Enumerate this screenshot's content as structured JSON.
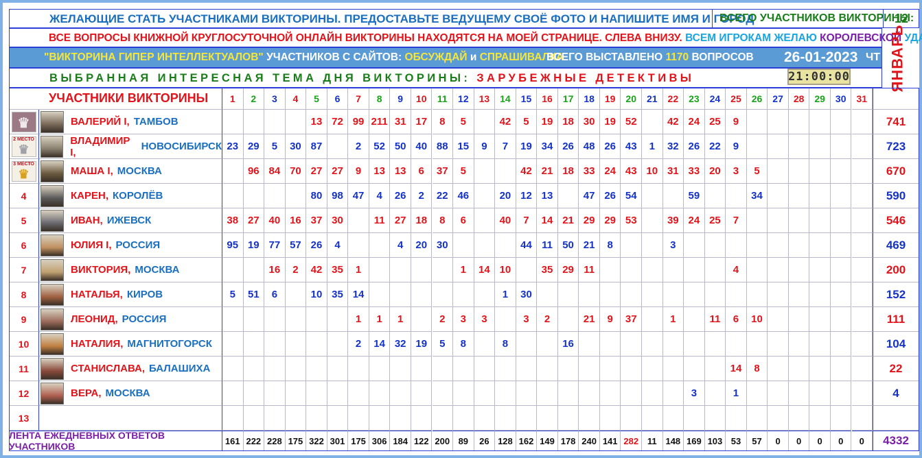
{
  "header": {
    "line1": "ЖЕЛАЮЩИЕ  СТАТЬ  УЧАСТНИКАМИ  ВИКТОРИНЫ.  ПРЕДОСТАВЬТЕ  ВЕДУЩЕМУ  СВОЁ  ФОТО  И  НАПИШИТЕ  ИМЯ И ГОРОД",
    "total_label": "ВСЕГО УЧАСТНИКОВ ВИКТОРИНЫ:",
    "total_value": "12",
    "line2_red": "ВСЕ ВОПРОСЫ КНИЖНОЙ КРУГЛОСУТОЧНОЙ ОНЛАЙН ВИКТОРИНЫ НАХОДЯТСЯ НА МОЕЙ СТРАНИЦЕ. СЛЕВА ВНИЗУ.",
    "line2_w1": "ВСЕМ",
    "line2_w2": "ИГРОКАМ",
    "line2_w3": "ЖЕЛАЮ",
    "line2_w4": "КОРОЛЕВСКОЙ",
    "line2_w5": "УДАЧИ!",
    "quiz_name": "\"ВИКТОРИНА ГИПЕР ИНТЕЛЛЕКТУАЛОВ\"",
    "sites_label": "УЧАСТНИКОВ С САЙТОВ:",
    "site1": "ОБСУЖДАЙ",
    "and": "и",
    "site2": "СПРАШИВАЛКА",
    "questions_label": "ВСЕГО ВЫСТАВЛЕНО",
    "questions_value": "1170",
    "questions_unit": "ВОПРОСОВ",
    "date": "26-01-2023",
    "weekday": "ЧТ",
    "month": "ЯНВАРЬ",
    "theme_label": "ВЫБРАННАЯ  ИНТЕРЕСНАЯ  ТЕМА  ДНЯ  ВИКТОРИНЫ:",
    "theme_value": "ЗАРУБЕЖНЫЕ  ДЕТЕКТИВЫ",
    "clock": "21:00:00"
  },
  "table": {
    "participants_header": "УЧАСТНИКИ ВИКТОРИНЫ",
    "days": [
      "1",
      "2",
      "3",
      "4",
      "5",
      "6",
      "7",
      "8",
      "9",
      "10",
      "11",
      "12",
      "13",
      "14",
      "15",
      "16",
      "17",
      "18",
      "19",
      "20",
      "21",
      "22",
      "23",
      "24",
      "25",
      "26",
      "27",
      "28",
      "29",
      "30",
      "31"
    ],
    "medals": [
      "",
      "2 МЕСТО",
      "3 МЕСТО"
    ],
    "rows": [
      {
        "rank": "1",
        "name": "ВАЛЕРИЙ I,",
        "city": "ТАМБОВ",
        "scores": [
          "",
          "",
          "",
          "",
          "13",
          "72",
          "99",
          "211",
          "31",
          "17",
          "8",
          "5",
          "",
          "42",
          "5",
          "19",
          "18",
          "30",
          "19",
          "52",
          "",
          "42",
          "24",
          "25",
          "9",
          "",
          "",
          "",
          "",
          "",
          ""
        ],
        "total": "741"
      },
      {
        "rank": "2",
        "name": "ВЛАДИМИР I,",
        "city": "НОВОСИБИРСК",
        "scores": [
          "23",
          "29",
          "5",
          "30",
          "87",
          "",
          "2",
          "52",
          "50",
          "40",
          "88",
          "15",
          "9",
          "7",
          "19",
          "34",
          "26",
          "48",
          "26",
          "43",
          "1",
          "32",
          "26",
          "22",
          "9",
          "",
          "",
          "",
          "",
          "",
          ""
        ],
        "total": "723"
      },
      {
        "rank": "3",
        "name": "МАША I,",
        "city": "МОСКВА",
        "scores": [
          "",
          "96",
          "84",
          "70",
          "27",
          "27",
          "9",
          "13",
          "13",
          "6",
          "37",
          "5",
          "",
          "",
          "42",
          "21",
          "18",
          "33",
          "24",
          "43",
          "10",
          "31",
          "33",
          "20",
          "3",
          "5",
          "",
          "",
          "",
          "",
          ""
        ],
        "total": "670"
      },
      {
        "rank": "4",
        "name": "КАРЕН,",
        "city": "КОРОЛЁВ",
        "scores": [
          "",
          "",
          "",
          "",
          "80",
          "98",
          "47",
          "4",
          "26",
          "2",
          "22",
          "46",
          "",
          "20",
          "12",
          "13",
          "",
          "47",
          "26",
          "54",
          "",
          "",
          "59",
          "",
          "",
          "34",
          "",
          "",
          "",
          "",
          ""
        ],
        "total": "590"
      },
      {
        "rank": "5",
        "name": "ИВАН,",
        "city": "ИЖЕВСК",
        "scores": [
          "38",
          "27",
          "40",
          "16",
          "37",
          "30",
          "",
          "11",
          "27",
          "18",
          "8",
          "6",
          "",
          "40",
          "7",
          "14",
          "21",
          "29",
          "29",
          "53",
          "",
          "39",
          "24",
          "25",
          "7",
          "",
          "",
          "",
          "",
          "",
          ""
        ],
        "total": "546"
      },
      {
        "rank": "6",
        "name": "ЮЛИЯ I,",
        "city": "РОССИЯ",
        "scores": [
          "95",
          "19",
          "77",
          "57",
          "26",
          "4",
          "",
          "",
          "4",
          "20",
          "30",
          "",
          "",
          "",
          "44",
          "11",
          "50",
          "21",
          "8",
          "",
          "",
          "3",
          "",
          "",
          "",
          "",
          "",
          "",
          "",
          "",
          ""
        ],
        "total": "469"
      },
      {
        "rank": "7",
        "name": "ВИКТОРИЯ,",
        "city": "МОСКВА",
        "scores": [
          "",
          "",
          "16",
          "2",
          "42",
          "35",
          "1",
          "",
          "",
          "",
          "",
          "1",
          "14",
          "10",
          "",
          "35",
          "29",
          "11",
          "",
          "",
          "",
          "",
          "",
          "",
          "4",
          "",
          "",
          "",
          "",
          "",
          ""
        ],
        "total": "200"
      },
      {
        "rank": "8",
        "name": "НАТАЛЬЯ,",
        "city": "КИРОВ",
        "scores": [
          "5",
          "51",
          "6",
          "",
          "10",
          "35",
          "14",
          "",
          "",
          "",
          "",
          "",
          "",
          "1",
          "30",
          "",
          "",
          "",
          "",
          "",
          "",
          "",
          "",
          "",
          "",
          "",
          "",
          "",
          "",
          "",
          ""
        ],
        "total": "152"
      },
      {
        "rank": "9",
        "name": "ЛЕОНИД,",
        "city": "РОССИЯ",
        "scores": [
          "",
          "",
          "",
          "",
          "",
          "",
          "1",
          "1",
          "1",
          "",
          "2",
          "3",
          "3",
          "",
          "3",
          "2",
          "",
          "21",
          "9",
          "37",
          "",
          "1",
          "",
          "11",
          "6",
          "10",
          "",
          "",
          "",
          "",
          ""
        ],
        "total": "111"
      },
      {
        "rank": "10",
        "name": "НАТАЛИЯ,",
        "city": "МАГНИТОГОРСК",
        "scores": [
          "",
          "",
          "",
          "",
          "",
          "",
          "2",
          "14",
          "32",
          "19",
          "5",
          "8",
          "",
          "8",
          "",
          "",
          "16",
          "",
          "",
          "",
          "",
          "",
          "",
          "",
          "",
          "",
          "",
          "",
          "",
          "",
          ""
        ],
        "total": "104"
      },
      {
        "rank": "11",
        "name": "СТАНИСЛАВА,",
        "city": "БАЛАШИХА",
        "scores": [
          "",
          "",
          "",
          "",
          "",
          "",
          "",
          "",
          "",
          "",
          "",
          "",
          "",
          "",
          "",
          "",
          "",
          "",
          "",
          "",
          "",
          "",
          "",
          "",
          "14",
          "8",
          "",
          "",
          "",
          "",
          ""
        ],
        "total": "22"
      },
      {
        "rank": "12",
        "name": "ВЕРА,",
        "city": "МОСКВА",
        "scores": [
          "",
          "",
          "",
          "",
          "",
          "",
          "",
          "",
          "",
          "",
          "",
          "",
          "",
          "",
          "",
          "",
          "",
          "",
          "",
          "",
          "",
          "",
          "3",
          "",
          "1",
          "",
          "",
          "",
          "",
          "",
          ""
        ],
        "total": "4"
      },
      {
        "rank": "13",
        "name": "",
        "city": "",
        "scores": [
          "",
          "",
          "",
          "",
          "",
          "",
          "",
          "",
          "",
          "",
          "",
          "",
          "",
          "",
          "",
          "",
          "",
          "",
          "",
          "",
          "",
          "",
          "",
          "",
          "",
          "",
          "",
          "",
          "",
          "",
          ""
        ],
        "total": ""
      }
    ],
    "footer_label": "ЛЕНТА ЕЖЕДНЕВНЫХ ОТВЕТОВ УЧАСТНИКОВ",
    "daily_totals": [
      "161",
      "222",
      "228",
      "175",
      "322",
      "301",
      "175",
      "306",
      "184",
      "122",
      "200",
      "89",
      "26",
      "128",
      "162",
      "149",
      "178",
      "240",
      "141",
      "282",
      "11",
      "148",
      "169",
      "103",
      "53",
      "57",
      "0",
      "0",
      "0",
      "0",
      "0"
    ],
    "grand_total": "4332"
  },
  "colors": {
    "red": "#e0141a",
    "blue": "#1431c8",
    "green": "#19a319",
    "purple": "#7a1fa8",
    "header_bar": "#5b9bd5",
    "border": "#7fb0e6"
  }
}
